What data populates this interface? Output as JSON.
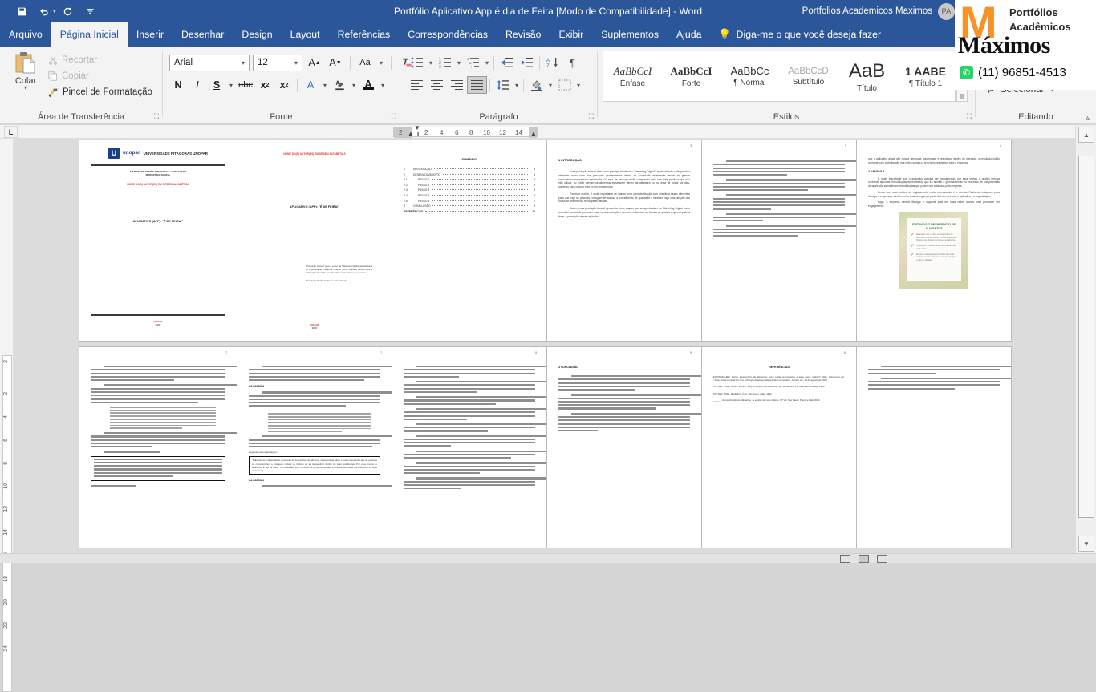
{
  "window": {
    "title": "Portfólio Aplicativo App é dia de Feira [Modo de Compatibilidade]  -  Word",
    "account_name": "Portfolios Academicos Maximos",
    "account_initials": "PA"
  },
  "quick_access": {
    "save": "save-icon",
    "undo": "undo-icon",
    "redo": "redo-icon",
    "customize": "customize-icon"
  },
  "tabs": [
    {
      "label": "Arquivo",
      "active": false
    },
    {
      "label": "Página Inicial",
      "active": true
    },
    {
      "label": "Inserir",
      "active": false
    },
    {
      "label": "Desenhar",
      "active": false
    },
    {
      "label": "Design",
      "active": false
    },
    {
      "label": "Layout",
      "active": false
    },
    {
      "label": "Referências",
      "active": false
    },
    {
      "label": "Correspondências",
      "active": false
    },
    {
      "label": "Revisão",
      "active": false
    },
    {
      "label": "Exibir",
      "active": false
    },
    {
      "label": "Suplementos",
      "active": false
    },
    {
      "label": "Ajuda",
      "active": false
    }
  ],
  "tell_me": {
    "placeholder": "Diga-me o que você deseja fazer"
  },
  "ribbon": {
    "clipboard": {
      "group_label": "Área de Transferência",
      "paste_label": "Colar",
      "cut_label": "Recortar",
      "copy_label": "Copiar",
      "format_painter_label": "Pincel de Formatação"
    },
    "font": {
      "group_label": "Fonte",
      "font_name": "Arial",
      "font_size": "12",
      "grow_font": "A",
      "shrink_font": "A",
      "change_case": "Aa",
      "clear_formatting": "clear-formatting-icon",
      "bold": "N",
      "italic": "I",
      "underline": "S",
      "strikethrough": "abc",
      "subscript": "x",
      "superscript": "x",
      "text_effects": "A",
      "highlight": "ab",
      "font_color": "A"
    },
    "paragraph": {
      "group_label": "Parágrafo",
      "bullets": "bullet-list-icon",
      "numbering": "numbered-list-icon",
      "multilevel": "multilevel-list-icon",
      "decrease_indent": "decrease-indent-icon",
      "increase_indent": "increase-indent-icon",
      "sort": "sort-icon",
      "show_marks": "¶",
      "align_left": "align-left-icon",
      "align_center": "align-center-icon",
      "align_right": "align-right-icon",
      "justify": "justify-icon",
      "line_spacing": "line-spacing-icon",
      "shading": "shading-icon",
      "borders": "borders-icon"
    },
    "styles": {
      "group_label": "Estilos",
      "items": [
        {
          "preview": "AaBbCcI",
          "name": "Ênfase"
        },
        {
          "preview": "AaBbCcI",
          "name": "Forte"
        },
        {
          "preview": "AaBbCc",
          "name": "¶ Normal"
        },
        {
          "preview": "AaBbCcD",
          "name": "Subtítulo"
        },
        {
          "preview": "AaB",
          "name": "Título"
        },
        {
          "preview": "1 AABE",
          "name": "¶ Título 1"
        }
      ]
    },
    "editing": {
      "group_label": "Editando",
      "select_label": "Selecionar"
    }
  },
  "ruler": {
    "tab_stop_marker": "L",
    "h_numbers": [
      "2",
      "2",
      "4",
      "6",
      "8",
      "10",
      "12",
      "14"
    ],
    "v_numbers": [
      "2",
      "2",
      "4",
      "6",
      "8",
      "10",
      "12",
      "14",
      "16",
      "18",
      "20",
      "22",
      "24"
    ]
  },
  "overlay_ad": {
    "brand_mark": "M",
    "line1": "Portfólios",
    "line2": "Acadêmicos",
    "line3": "Máximos",
    "whatsapp_icon": "whatsapp-icon",
    "phone": "(11) 96851-4513",
    "brand_color": "#f5922a"
  },
  "document": {
    "pages": [
      {
        "page_number": "",
        "kind": "cover",
        "university": "UNIVERSIDADE PITÁGORAS UNOPAR",
        "logo_word": "unopar",
        "subtitle_1": "SISTEMA DE ENSINO PRESENCIAL CONECTADO",
        "subtitle_2": "MARKETING DIGITAL",
        "authors": "NOME DO(S) AUTOR(ES) EM ORDEM ALFABÉTICA",
        "main_title": "APLICATIVO (APP): \"É DE FEIRA!\"",
        "city": "CIDADE",
        "year": "2020"
      },
      {
        "page_number": "",
        "kind": "cover2",
        "authors": "NOME DO(S) AUTOR(ES) EM ORDEM ALFABÉTICA",
        "main_title": "APLICATIVO (APP): \"É DE FEIRA!\"",
        "note": "Produção Textual para o curso de Marketing Digital apresentada à Universidade Pitágoras Unopar, como requisito parcial para a obtenção de média das disciplinas norteadoras do semestre.",
        "tutors": "Tutor(a) à Distância: Nome do(a) Tutor(a).",
        "city": "CIDADE",
        "year": "2020"
      },
      {
        "page_number": "",
        "kind": "toc",
        "heading": "SUMÁRIO",
        "entries": [
          {
            "no": "1",
            "text": "INTRODUÇÃO",
            "page": "3"
          },
          {
            "no": "2",
            "text": "DESENVOLVIMENTO",
            "page": "4"
          },
          {
            "no": "2.1",
            "text": "PASSO 1",
            "page": "4"
          },
          {
            "no": "2.2",
            "text": "PASSO 2",
            "page": "5"
          },
          {
            "no": "2.3",
            "text": "PASSO 3",
            "page": "6"
          },
          {
            "no": "2.4",
            "text": "PASSO 4",
            "page": "7"
          },
          {
            "no": "2.5",
            "text": "PASSO 5",
            "page": "7"
          },
          {
            "no": "3",
            "text": "CONCLUSÃO",
            "page": "9"
          },
          {
            "no": "",
            "text": "REFERÊNCIAS",
            "page": "10"
          }
        ]
      },
      {
        "page_number": "3",
        "kind": "text",
        "heading": "1 INTRODUÇÃO",
        "paragraphs": [
          "Essa produção textual tem como principal temática o \"Marketing Digital\", apresentando o desperdício alimentar como uma das principais problemáticas dentro da sociedade atualmente devido ao grande consumismo normalizado pela mídia. Ou seja, as pessoas estão comprando cada vez mais produtos que não irão utilizar, ou então deixam os alimentos estragarem dentro da geladeira ou na cesta de frutas por dias, correndo para colocar elas no lixo em seguida.",
          "Por esse motivo, é muito importante se manter uma conscientização com relação a esses alimentos para que haja as pessoas consigam ter acesso a um alimento de qualidade e também haja uma relação dos níveis de desperdício feitos pelas famílias.",
          "Assim, essa produção textual apresenta cinco etapas que se aprofundam no Marketing Digital como uma das formas de promover essa conscientização e também evidenciar as formas as quais a empresa poderá fazer a promoção de seu aplicativo."
        ]
      },
      {
        "page_number": "6",
        "kind": "text-image",
        "heading": "2.3 PASSO 3",
        "lead": "que o aplicativo ainda não possui nenhuma notoriedade e relevância dentro do mercado, o resultado sólido somente com a divulgação nas redes sociais já terá bons resultados para a empresa.",
        "paragraphs": [
          "É muito importante que o aplicativo consiga ser popularizado, por esse motivo a gestão precisa conhecer algumas metodologias de marketing que irá auxiliar o gerenciamento no processo de compreensão de quais são as melhores metodologias que podem ser adotadas pela empresa.",
          "Desta vez, uma política de engajamento muito interessante é o uso do Reels do Instagram para divulgar a empresa e também criar uma sinergia por parte dos clientes com o aplicativo e a organização.",
          "Logo, a empresa deverá divulgar o seguinte post em suas redes sociais para promover um engajamento:"
        ],
        "image": {
          "title": "EVITANDO O DESPERDÍCIO DE ALIMENTOS",
          "bullets": [
            "De acordo com o Índice de Desperdício de Alimentos 2021 em média, o Brasil desperdiça 60 quilos de alimento por pessoa anualmente.",
            "O aplicativo \"É dia de Feira!\" busca evitar esse desperdício.",
            "Encontre nas semanas de mídia e faça suas compras com os alimentos certos que chegam a data de validade."
          ]
        }
      },
      {
        "page_number": "",
        "kind": "text",
        "heading": "",
        "paragraphs": []
      },
      {
        "page_number": "7",
        "kind": "text-framed",
        "heading": "2.3 PASSO 3",
        "heading2": "2.4 PASSO 4",
        "caption_label": "Legenda para a postagem:",
        "framed_text": "\"Sabendo as problemáticas a respeito do desperdício de alimento na sociedade atual, é muito importante que as pessoas se conscientizem e busquem reduzir os índices de tal desperdício dentro de suas residências. Por esse motivo, o aplicativo 'É dia de Feira!' foi idealizado com o intuito de proporcionar aos indivíduos um maior controle com os seus consumos\"",
        "paragraphs": []
      },
      {
        "page_number": "9",
        "kind": "text",
        "heading": "3 CONCLUSÃO",
        "paragraphs": []
      },
      {
        "page_number": "10",
        "kind": "refs",
        "heading": "REFERÊNCIAS",
        "entries": [
          "ECOWATCHER. Portal. Desperdício de alimentos: você sabia os impactos e sabe como reduzir? 2021. Disponível em: <https://www.ecowatcher.com.br/blog/noticias/tema/desperdicio-alimentos>. Acesso em: 12 de agosto de 2023.",
          "KOTLER, Philip; ARMSTRONG, Gary. Princípios de marketing. Rio de Janeiro: Prentice-Hall do Brasil, 1993.",
          "KOTLER, Philip. Marketing. 3.ed. São Paulo: Atlas, 1992.",
          "______. Administração de Marketing - a edição do novo milênio. 10ª ed. São Paulo: Prentice Hall, 2000."
        ]
      }
    ]
  },
  "status_bar": {
    "view_print_layout": "print-layout-icon",
    "view_read_mode": "read-mode-icon",
    "view_web_layout": "web-layout-icon"
  }
}
